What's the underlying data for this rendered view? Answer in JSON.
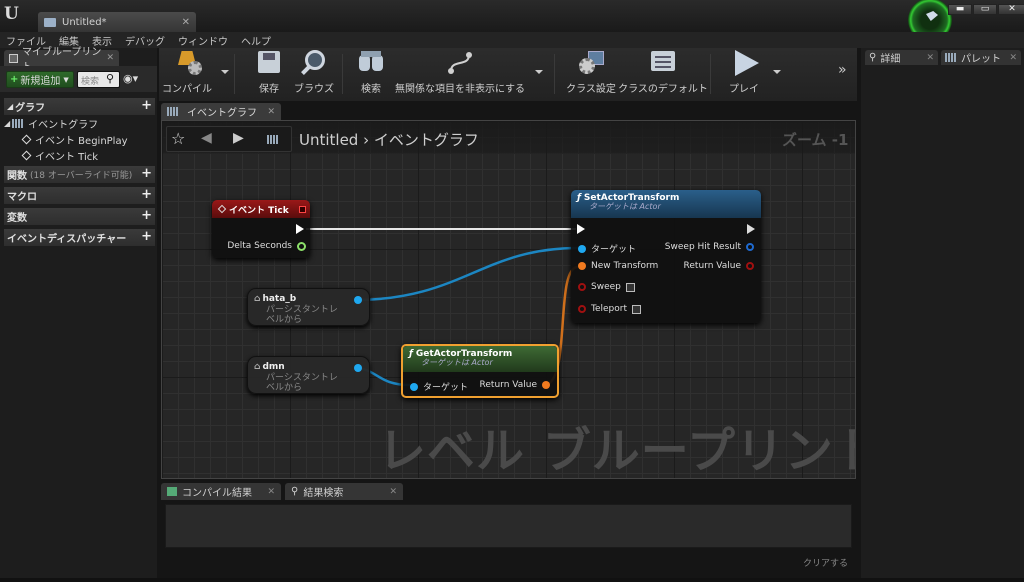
{
  "app": {
    "logo": "U",
    "doc_tab_title": "Untitled*"
  },
  "window_controls": [
    "▬",
    "▭",
    "✕"
  ],
  "menu": [
    "ファイル",
    "編集",
    "表示",
    "デバッグ",
    "ウィンドウ",
    "ヘルプ"
  ],
  "left_panel": {
    "tab_title": "マイブループリント",
    "add_new": "新規追加",
    "search_placeholder": "検索",
    "sections": {
      "graph": "グラフ",
      "functions": "関数",
      "functions_sub": "(18 オーバーライド可能)",
      "macros": "マクロ",
      "variables": "変数",
      "dispatchers": "イベントディスパッチャー"
    },
    "tree": {
      "event_graph": "イベントグラフ",
      "begin_play": "イベント BeginPlay",
      "tick": "イベント Tick"
    }
  },
  "toolbar": {
    "compile": "コンパイル",
    "save": "保存",
    "browse": "ブラウズ",
    "search": "検索",
    "hide_unrelated": "無関係な項目を非表示にする",
    "class_settings": "クラス設定",
    "class_defaults": "クラスのデフォルト",
    "play": "プレイ"
  },
  "graph": {
    "tab_title": "イベントグラフ",
    "breadcrumb": "Untitled",
    "breadcrumb_sep": "›",
    "breadcrumb_current": "イベントグラフ",
    "zoom": "ズーム -1",
    "watermark": "レベル ブループリント",
    "nodes": {
      "event_tick": {
        "title": "イベント Tick",
        "delta": "Delta Seconds"
      },
      "set_actor_transform": {
        "title": "SetActorTransform",
        "subtitle": "ターゲットは Actor",
        "target": "ターゲット",
        "new_transform": "New Transform",
        "sweep": "Sweep",
        "teleport": "Teleport",
        "sweep_hit": "Sweep Hit Result",
        "return_value": "Return Value"
      },
      "get_actor_transform": {
        "title": "GetActorTransform",
        "subtitle": "ターゲットは Actor",
        "target": "ターゲット",
        "return_value": "Return Value"
      },
      "hata_b": {
        "name": "hata_b",
        "sub": "パーシスタントレベルから"
      },
      "dmn": {
        "name": "dmn",
        "sub": "パーシスタントレベルから"
      }
    }
  },
  "bottom": {
    "compile_results": "コンパイル結果",
    "find_results": "結果検索",
    "clear": "クリアする"
  },
  "right_panel": {
    "details": "詳細",
    "palette": "パレット"
  },
  "colors": {
    "event_red": "#8a1414",
    "func_blue": "#1d4b6e",
    "func_green": "#2d4d25",
    "pin_blue": "#1fa8f0",
    "pin_orange": "#f07a1f",
    "wire_blue": "#1c86c2",
    "wire_orange": "#d0701c",
    "selected_border": "#f0a030"
  }
}
